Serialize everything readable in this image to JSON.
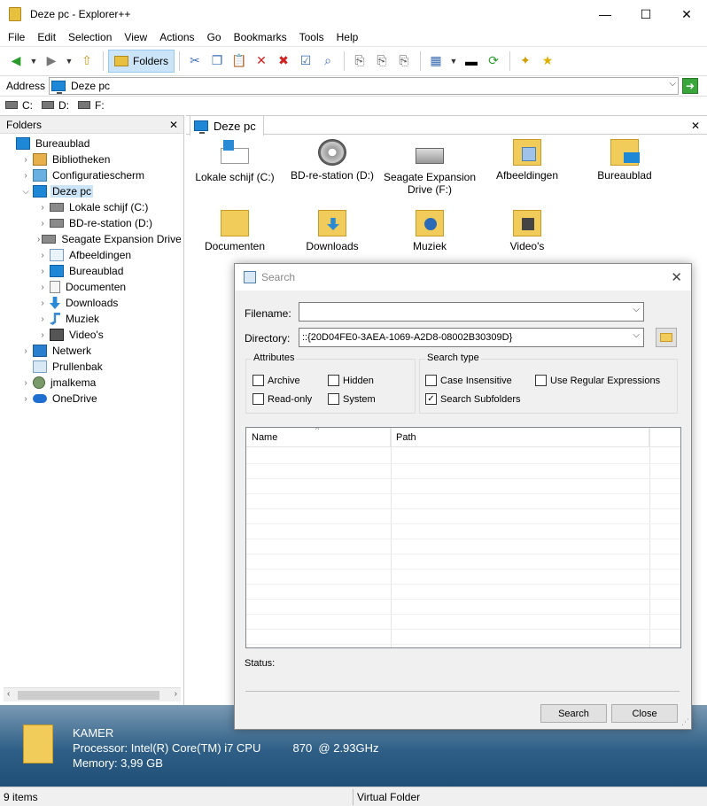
{
  "window": {
    "title": "Deze pc - Explorer++",
    "controls": {
      "minimize": "—",
      "maximize": "☐",
      "close": "✕"
    }
  },
  "menu": [
    "File",
    "Edit",
    "Selection",
    "View",
    "Actions",
    "Go",
    "Bookmarks",
    "Tools",
    "Help"
  ],
  "toolbar": {
    "folders_label": "Folders"
  },
  "address": {
    "label": "Address",
    "value": "Deze pc"
  },
  "drives": [
    "C:",
    "D:",
    "F:"
  ],
  "folders_pane": {
    "title": "Folders",
    "tree": [
      {
        "label": "Bureaublad",
        "icon": "pc",
        "indent": 0,
        "exp": ""
      },
      {
        "label": "Bibliotheken",
        "icon": "lib",
        "indent": 1,
        "exp": ">"
      },
      {
        "label": "Configuratiescherm",
        "icon": "cp",
        "indent": 1,
        "exp": ">"
      },
      {
        "label": "Deze pc",
        "icon": "pc",
        "indent": 1,
        "exp": "v",
        "selected": true
      },
      {
        "label": "Lokale schijf (C:)",
        "icon": "disk",
        "indent": 2,
        "exp": ">"
      },
      {
        "label": "BD-re-station (D:)",
        "icon": "disk",
        "indent": 2,
        "exp": ">"
      },
      {
        "label": "Seagate Expansion Drive (F:)",
        "icon": "disk",
        "indent": 2,
        "exp": ">"
      },
      {
        "label": "Afbeeldingen",
        "icon": "pic",
        "indent": 2,
        "exp": ">"
      },
      {
        "label": "Bureaublad",
        "icon": "pc",
        "indent": 2,
        "exp": ">"
      },
      {
        "label": "Documenten",
        "icon": "doc",
        "indent": 2,
        "exp": ">"
      },
      {
        "label": "Downloads",
        "icon": "dl",
        "indent": 2,
        "exp": ">"
      },
      {
        "label": "Muziek",
        "icon": "music",
        "indent": 2,
        "exp": ">"
      },
      {
        "label": "Video's",
        "icon": "video",
        "indent": 2,
        "exp": ">"
      },
      {
        "label": "Netwerk",
        "icon": "net",
        "indent": 1,
        "exp": ">"
      },
      {
        "label": "Prullenbak",
        "icon": "bin",
        "indent": 1,
        "exp": ""
      },
      {
        "label": "jmalkema",
        "icon": "user",
        "indent": 1,
        "exp": ">"
      },
      {
        "label": "OneDrive",
        "icon": "cloud",
        "indent": 1,
        "exp": ">"
      }
    ]
  },
  "tab": {
    "label": "Deze pc"
  },
  "files": [
    {
      "label": "Lokale schijf (C:)",
      "icon": "winlogo"
    },
    {
      "label": "BD-re-station (D:)",
      "icon": "bd"
    },
    {
      "label": "Seagate Expansion Drive (F:)",
      "icon": "disk"
    },
    {
      "label": "Afbeeldingen",
      "icon": "folder-pic"
    },
    {
      "label": "Bureaublad",
      "icon": "folder-blue"
    },
    {
      "label": "Documenten",
      "icon": "folder"
    },
    {
      "label": "Downloads",
      "icon": "folder-dl"
    },
    {
      "label": "Muziek",
      "icon": "folder-music"
    },
    {
      "label": "Video's",
      "icon": "folder-video"
    }
  ],
  "info": {
    "computer": "KAMER",
    "processor": "Processor: Intel(R) Core(TM) i7 CPU          870  @ 2.93GHz",
    "memory": "Memory: 3,99 GB"
  },
  "statusbar": {
    "items": "9 items",
    "folder_type": "Virtual Folder"
  },
  "search_dialog": {
    "title": "Search",
    "filename_label": "Filename:",
    "filename_value": "",
    "directory_label": "Directory:",
    "directory_value": "::{20D04FE0-3AEA-1069-A2D8-08002B30309D}",
    "attributes_title": "Attributes",
    "attributes": {
      "archive": "Archive",
      "hidden": "Hidden",
      "readonly": "Read-only",
      "system": "System"
    },
    "search_type_title": "Search type",
    "search_types": {
      "case": "Case Insensitive",
      "regex": "Use Regular Expressions",
      "subfolders": "Search Subfolders"
    },
    "checked": {
      "archive": false,
      "hidden": false,
      "readonly": false,
      "system": false,
      "case": false,
      "regex": false,
      "subfolders": true
    },
    "columns": [
      "Name",
      "Path"
    ],
    "status_label": "Status:",
    "search_button": "Search",
    "close_button": "Close"
  }
}
